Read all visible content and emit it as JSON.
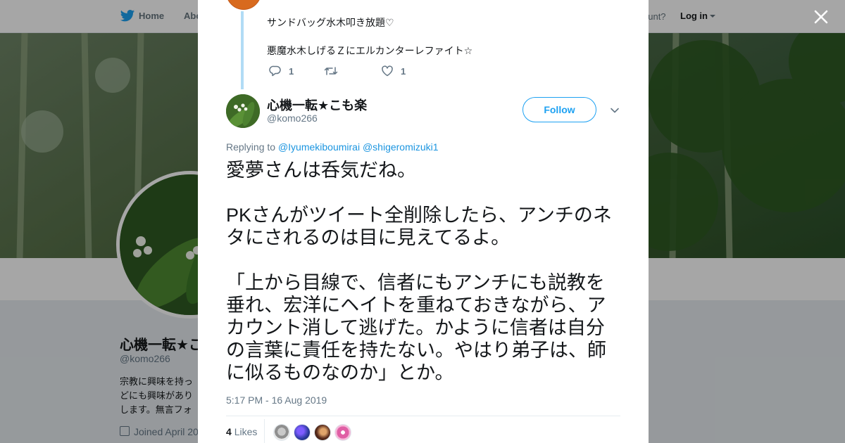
{
  "topbar": {
    "home_label": "Home",
    "about_label": "Abo",
    "account_text": "ccount?",
    "login_label": "Log in"
  },
  "profile": {
    "name": "心機一転★こ",
    "handle": "@komo266",
    "bio": "宗教に興味を持っ\nどにも興味があり\nします。無言フォ",
    "joined": "Joined April 20"
  },
  "previous_tweet": {
    "line1": "サンドバッグ水木叩き放題♡",
    "line2": "悪魔水木しげるＺにエルカンターレファイト☆",
    "reply_count": "1",
    "retweet_count": "",
    "like_count": "1"
  },
  "tweet": {
    "author_name": "心機一転★こも楽",
    "author_handle": "@komo266",
    "follow_label": "Follow",
    "replying_prefix": "Replying to ",
    "replying_to": [
      "@Iyumekiboumirai",
      "@shigeromizuki1"
    ],
    "text": "愛夢さんは呑気だね。\n\nPKさんがツイート全削除したら、アンチのネタにされるのは目に見えてるよ。\n\n「上から目線で、信者にもアンチにも説教を垂れ、宏洋にヘイトを重ねておきながら、アカウント消して逃げた。かように信者は自分の言葉に責任を持たない。やはり弟子は、師に似るものなのか」とか。",
    "timestamp": "5:17 PM - 16 Aug 2019",
    "likes_count": "4",
    "likes_label": "Likes"
  },
  "colors": {
    "accent": "#1da1f2",
    "link": "#1b95e0",
    "thread_line": "#b1dcf5",
    "secondary_text": "#657786"
  },
  "icons": [
    "twitter-bird-icon",
    "close-icon",
    "reply-icon",
    "retweet-icon",
    "like-icon",
    "chevron-down-icon",
    "calendar-icon"
  ]
}
